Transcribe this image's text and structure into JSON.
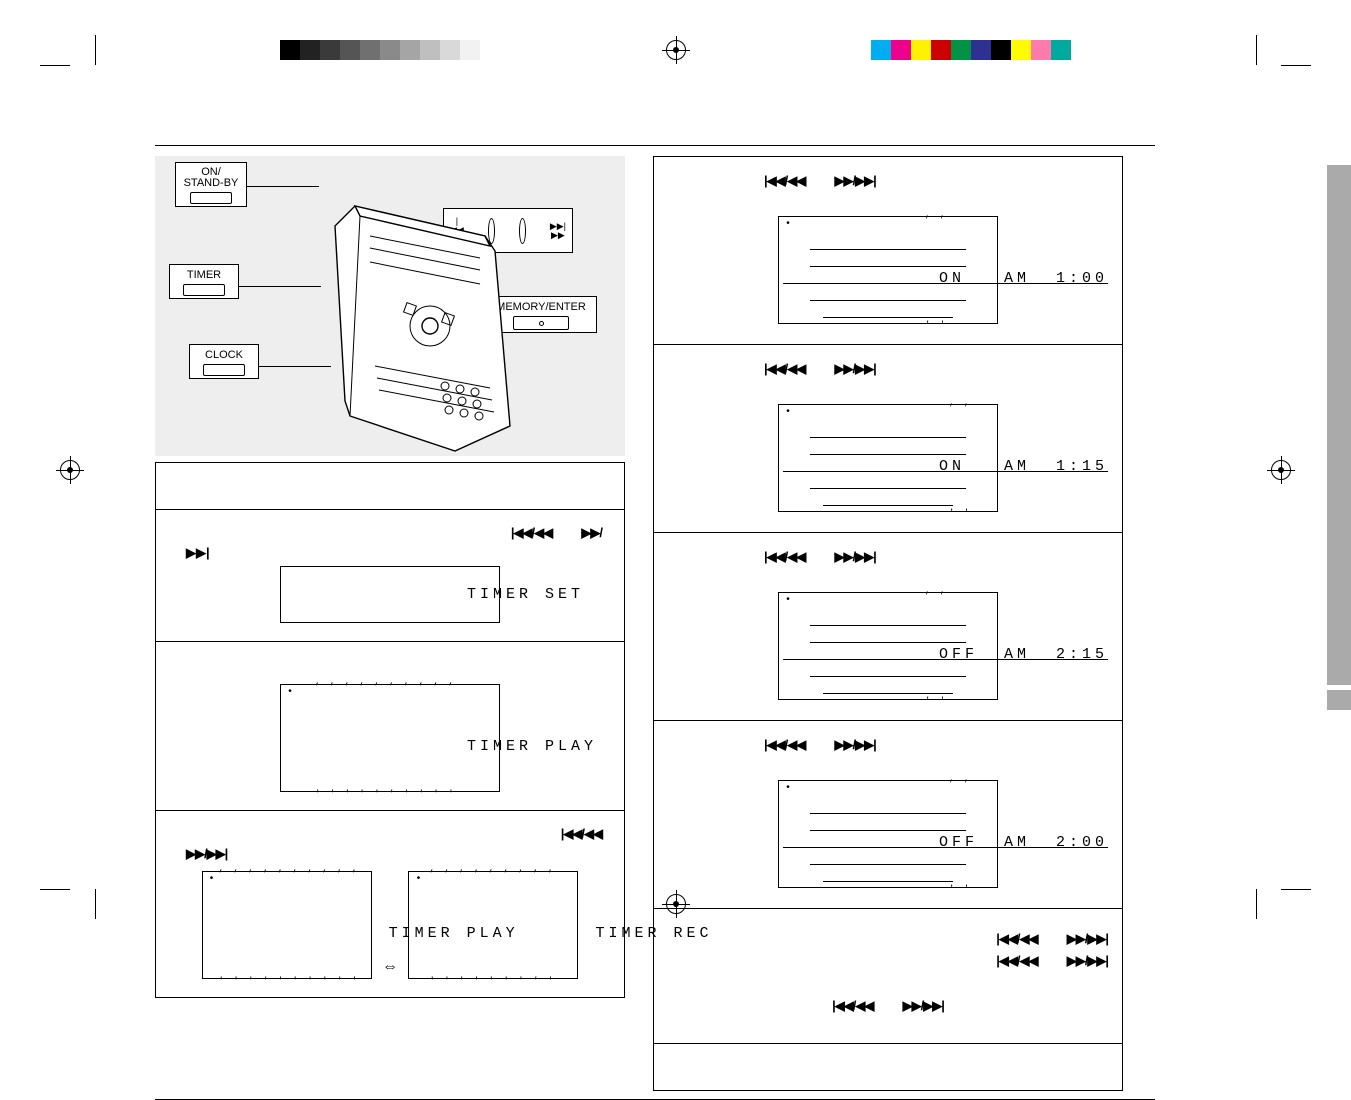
{
  "callouts": {
    "standby": "ON/\nSTAND-BY",
    "timer": "TIMER",
    "clock": "CLOCK",
    "memory": "MEMORY/ENTER"
  },
  "skip_glyphs": {
    "rew": "|◀◀/◀◀",
    "fwd": "▶▶/▶▶|"
  },
  "left_steps": {
    "lcd_timer_set": "TIMER SET",
    "lcd_timer_play": "TIMER PLAY",
    "lcd_timer_play2": "TIMER PLAY",
    "lcd_timer_rec": "TIMER REC"
  },
  "right_steps": [
    {
      "lcd": "ON   AM  1:00"
    },
    {
      "lcd": "ON   AM  1:15"
    },
    {
      "lcd": "OFF  AM  2:15"
    },
    {
      "lcd": "OFF  AM  2:00"
    }
  ]
}
